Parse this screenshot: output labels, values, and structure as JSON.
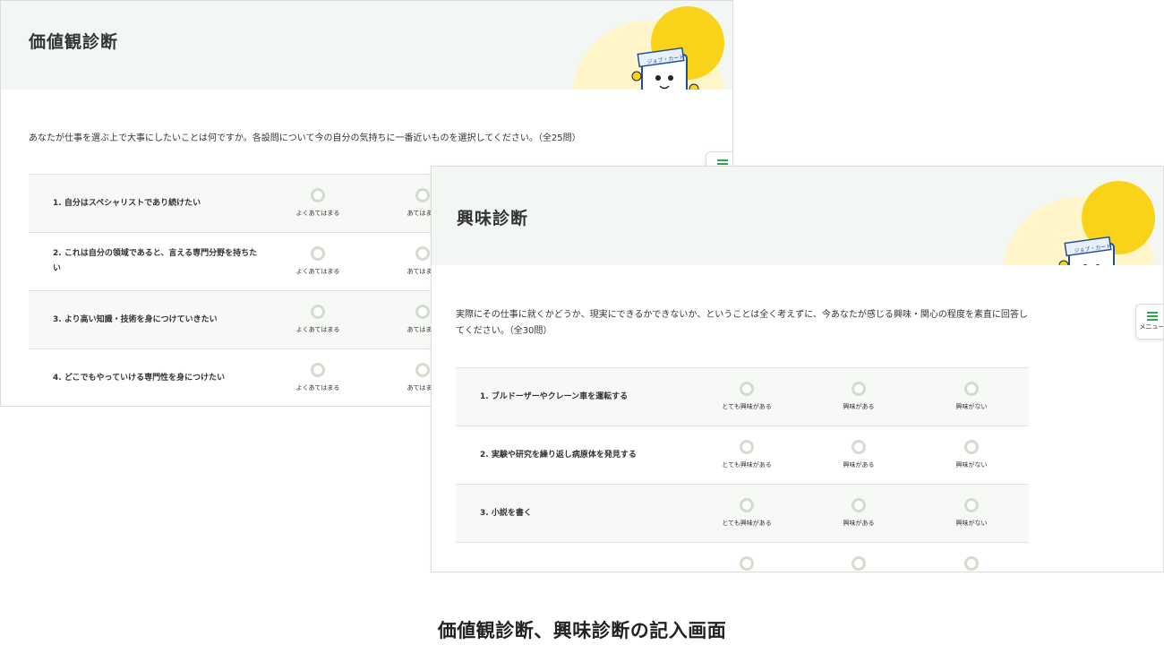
{
  "values_panel": {
    "title": "価値観診断",
    "intro": "あなたが仕事を選ぶ上で大事にしたいことは何ですか。各設問について今の自分の気持ちに一番近いものを選択してください。（全25問）",
    "questions": [
      {
        "text": "1. 自分はスペシャリストであり続けたい",
        "options": [
          "よくあてはまる",
          "あてはまる"
        ]
      },
      {
        "text": "2. これは自分の領域であると、言える専門分野を持ちたい",
        "options": [
          "よくあてはまる",
          "あてはまる"
        ]
      },
      {
        "text": "3. より高い知識・技術を身につけていきたい",
        "options": [
          "よくあてはまる",
          "あてはまる"
        ]
      },
      {
        "text": "4. どこでもやっていける専門性を身につけたい",
        "options": [
          "よくあてはまる",
          "あてはまる"
        ]
      }
    ]
  },
  "interest_panel": {
    "title": "興味診断",
    "intro": "実際にその仕事に就くかどうか、現実にできるかできないか、ということは全く考えずに、今あなたが感じる興味・関心の程度を素直に回答してください。（全30問）",
    "questions": [
      {
        "text": "1. ブルドーザーやクレーン車を運転する",
        "options": [
          "とても興味がある",
          "興味がある",
          "興味がない"
        ]
      },
      {
        "text": "2. 実験や研究を繰り返し病原体を発見する",
        "options": [
          "とても興味がある",
          "興味がある",
          "興味がない"
        ]
      },
      {
        "text": "3. 小説を書く",
        "options": [
          "とても興味がある",
          "興味がある",
          "興味がない"
        ]
      }
    ],
    "menu_label": "メニュー"
  },
  "mascot_label": "ジョブ・カード",
  "caption": "価値観診断、興味診断の記入画面",
  "colors": {
    "accent_green": "#2fa44f",
    "header_bg": "#f3f7f4",
    "yellow": "#f9d21a",
    "pale_yellow": "#fff5c9",
    "radio_ring": "#d4dccd"
  }
}
